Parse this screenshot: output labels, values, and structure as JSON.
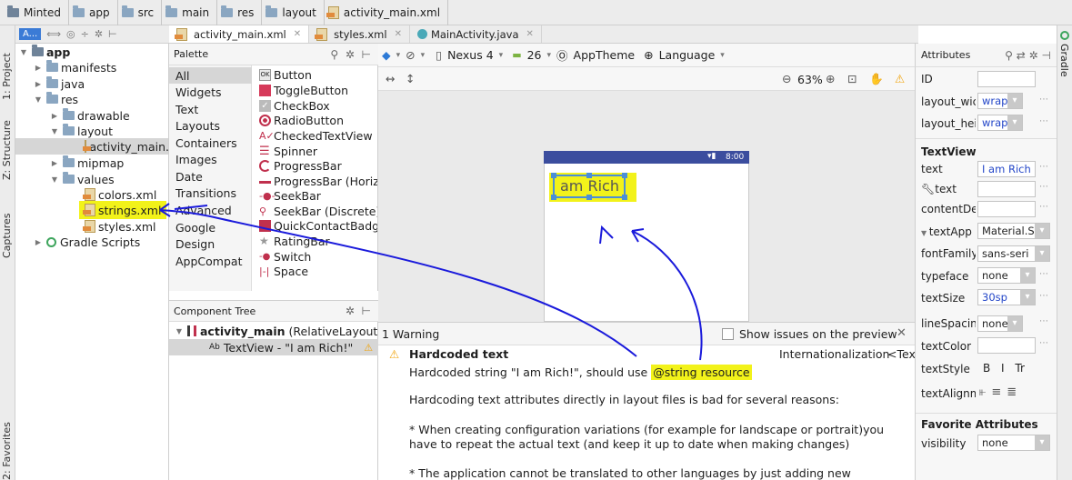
{
  "breadcrumb": [
    "Minted",
    "app",
    "src",
    "main",
    "res",
    "layout",
    "activity_main.xml"
  ],
  "left_strip": {
    "project": "1: Project",
    "structure": "Z: Structure",
    "captures": "Captures",
    "favorites": "2: Favorites"
  },
  "right_strip": {
    "gradle": "Gradle"
  },
  "project_header": "A...",
  "project_tree": [
    {
      "label": "app",
      "depth": 0,
      "type": "module",
      "expanded": true
    },
    {
      "label": "manifests",
      "depth": 1,
      "type": "folder",
      "expanded": false
    },
    {
      "label": "java",
      "depth": 1,
      "type": "folder",
      "expanded": false
    },
    {
      "label": "res",
      "depth": 1,
      "type": "folder",
      "expanded": true
    },
    {
      "label": "drawable",
      "depth": 2,
      "type": "folder",
      "expanded": false
    },
    {
      "label": "layout",
      "depth": 2,
      "type": "folder",
      "expanded": true
    },
    {
      "label": "activity_main.",
      "depth": 3,
      "type": "xml",
      "selected": true
    },
    {
      "label": "mipmap",
      "depth": 2,
      "type": "folder",
      "expanded": false
    },
    {
      "label": "values",
      "depth": 2,
      "type": "folder",
      "expanded": true
    },
    {
      "label": "colors.xml",
      "depth": 3,
      "type": "xml"
    },
    {
      "label": "strings.xml",
      "depth": 3,
      "type": "xml",
      "highlight": true
    },
    {
      "label": "styles.xml",
      "depth": 3,
      "type": "xml"
    },
    {
      "label": "Gradle Scripts",
      "depth": 0,
      "type": "gradle",
      "expanded": false
    }
  ],
  "editor_tabs": [
    {
      "label": "activity_main.xml",
      "active": true
    },
    {
      "label": "styles.xml",
      "active": false
    },
    {
      "label": "MainActivity.java",
      "active": false
    }
  ],
  "palette": {
    "title": "Palette",
    "categories": [
      "All",
      "Widgets",
      "Text",
      "Layouts",
      "Containers",
      "Images",
      "Date",
      "Transitions",
      "Advanced",
      "Google",
      "Design",
      "AppCompat"
    ],
    "items": [
      "Button",
      "ToggleButton",
      "CheckBox",
      "RadioButton",
      "CheckedTextView",
      "Spinner",
      "ProgressBar",
      "ProgressBar (Horizo",
      "SeekBar",
      "SeekBar (Discrete)",
      "QuickContactBadge",
      "RatingBar",
      "Switch",
      "Space"
    ]
  },
  "component_tree": {
    "title": "Component Tree",
    "root": "activity_main",
    "root_type": "(RelativeLayout)",
    "child": "TextView - \"I am Rich!\""
  },
  "design_toolbar": {
    "device": "Nexus 4",
    "api": "26",
    "theme": "AppTheme",
    "language": "Language",
    "zoom": "63%"
  },
  "device_preview": {
    "time": "8:00",
    "text": "am Rich"
  },
  "warnings": {
    "count_label": "1 Warning",
    "show_issues": "Show issues on the preview",
    "title": "Hardcoded text",
    "category": "Internationalization",
    "category_more": "<Text",
    "line1": "Hardcoded string \"I am Rich!\", should use ",
    "line1_link": "@string resource",
    "line2": "Hardcoding text attributes directly in layout files is bad for several reasons:",
    "line3": "* When creating configuration variations (for example for landscape or portrait)you",
    "line4": "have to repeat the actual text (and keep it up to date when making changes)",
    "line5": "* The application cannot be translated to other languages by just adding new"
  },
  "attributes": {
    "title": "Attributes",
    "rows": [
      {
        "label": "ID",
        "value": "",
        "kind": "box"
      },
      {
        "label": "layout_wic",
        "value": "wrap_",
        "kind": "drop"
      },
      {
        "label": "layout_hei",
        "value": "wrap_",
        "kind": "drop"
      },
      {
        "label": "TextView",
        "value": "",
        "kind": "section"
      },
      {
        "label": "text",
        "value": "I am Rich",
        "kind": "box"
      },
      {
        "label": "text",
        "value": "",
        "kind": "box"
      },
      {
        "label": "contentDe",
        "value": "",
        "kind": "box"
      },
      {
        "label": "textApp",
        "value": "Material.S",
        "kind": "drop"
      },
      {
        "label": "fontFamily",
        "value": "sans-seri",
        "kind": "drop"
      },
      {
        "label": "typeface",
        "value": "none",
        "kind": "drop"
      },
      {
        "label": "textSize",
        "value": "30sp",
        "kind": "drop"
      },
      {
        "label": "lineSpacin",
        "value": "none",
        "kind": "drop"
      },
      {
        "label": "textColor",
        "value": "",
        "kind": "box"
      },
      {
        "label": "textStyle",
        "value": "B I Tr",
        "kind": "style"
      },
      {
        "label": "textAlignm",
        "value": "",
        "kind": "align"
      },
      {
        "label": "Favorite Attributes",
        "value": "",
        "kind": "section"
      },
      {
        "label": "visibility",
        "value": "none",
        "kind": "drop"
      }
    ]
  },
  "colors": {
    "accent": "#3b4d9e",
    "highlight": "#f2f21a",
    "annotation": "#1a1adb",
    "warning": "#f0a30a"
  }
}
